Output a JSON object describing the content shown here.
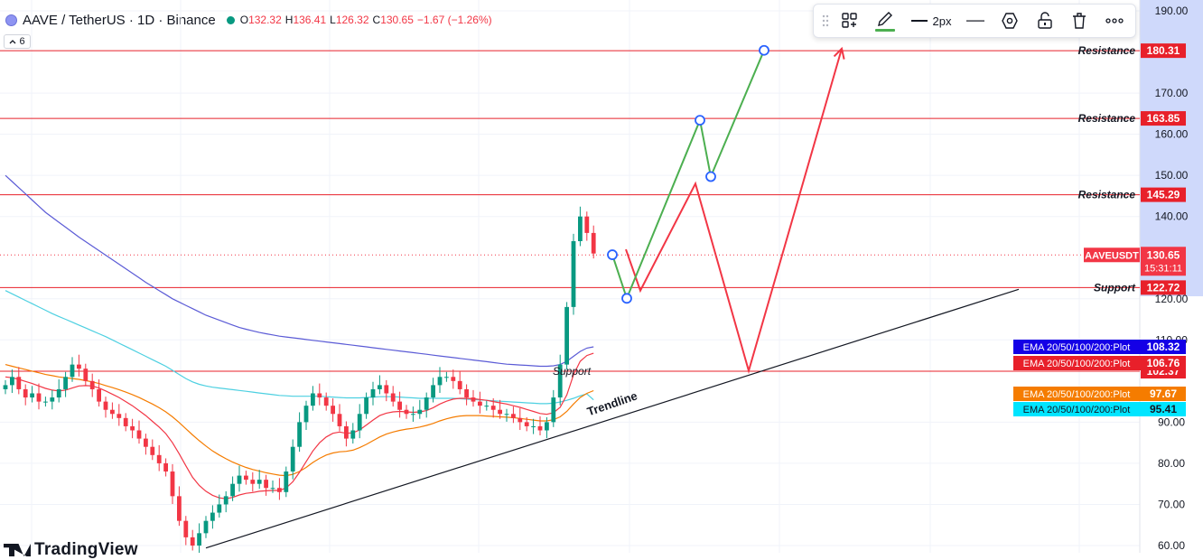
{
  "header": {
    "symbol": "AAVE / TetherUS · 1D · Binance",
    "open_key": "O",
    "open": "132.32",
    "high_key": "H",
    "high": "136.41",
    "low_key": "L",
    "low": "126.32",
    "close_key": "C",
    "close": "130.65",
    "change": "−1.67 (−1.26%)",
    "indicator_count": "6"
  },
  "toolbar": {
    "stroke_width": "2px"
  },
  "watermark": {
    "text": "TradingView"
  },
  "colors": {
    "up": "#089981",
    "down": "#f23645",
    "ema20": "#f23645",
    "ema50": "#f57c00",
    "ema100": "#4dd0e1",
    "ema200": "#5b5bd6",
    "projection_up": "#4caf50",
    "projection_down": "#f23645",
    "accent": "#2962ff"
  },
  "chart_data": {
    "type": "candlestick",
    "y_axis": {
      "min": 60,
      "max": 190,
      "ticks": [
        "190.00",
        "170.00",
        "160.00",
        "150.00",
        "140.00",
        "120.00",
        "110.00",
        "90.00",
        "80.00",
        "70.00",
        "60.00"
      ]
    },
    "levels": [
      {
        "label": "Resistance",
        "value": 180.31,
        "tag": "180.31"
      },
      {
        "label": "Resistance",
        "value": 163.85,
        "tag": "163.85"
      },
      {
        "label": "Resistance",
        "value": 145.29,
        "tag": "145.29"
      },
      {
        "label": "Support",
        "value": 122.72,
        "tag": "122.72"
      },
      {
        "label": "Support",
        "value": 102.37,
        "tag": "102.37"
      }
    ],
    "last_price": {
      "symbol": "AAVEUSDT",
      "value": 130.65,
      "tag": "130.65",
      "countdown": "15:31:11"
    },
    "ema_tags": [
      {
        "label": "EMA 20/50/100/200:Plot",
        "value": 108.32,
        "tag": "108.32",
        "color": "#1400e6"
      },
      {
        "label": "EMA 20/50/100/200:Plot",
        "value": 106.76,
        "tag": "106.76",
        "color": "#e8202a"
      },
      {
        "label": "EMA 20/50/100/200:Plot",
        "value": 97.67,
        "tag": "97.67",
        "color": "#f57c00"
      },
      {
        "label": "EMA 20/50/100/200:Plot",
        "value": 95.41,
        "tag": "95.41",
        "color": "#00e5ff"
      }
    ],
    "trendline_label": "Trendline",
    "candles_close": [
      99,
      101,
      98,
      96,
      97,
      95,
      95,
      96,
      98,
      101,
      104,
      103,
      100,
      98,
      95,
      93,
      92,
      91,
      89,
      88,
      86,
      84,
      82,
      80,
      78,
      72,
      66,
      62,
      60,
      63,
      66,
      68,
      70,
      72,
      75,
      77,
      76,
      75,
      76,
      74,
      74,
      73,
      78,
      84,
      90,
      94,
      97,
      96,
      94,
      92,
      89,
      86,
      88,
      92,
      96,
      98,
      99,
      97,
      95,
      93,
      92,
      92,
      93,
      96,
      99,
      101,
      101,
      100,
      98,
      96,
      95,
      94,
      94,
      93,
      92,
      92,
      91,
      90,
      89,
      89,
      88,
      90,
      96,
      104,
      118,
      134,
      140,
      136,
      131
    ],
    "ema200": [
      150,
      148.5,
      147,
      145.5,
      144,
      142.5,
      141,
      139.8,
      138.6,
      137.4,
      136.2,
      135,
      133.9,
      132.8,
      131.7,
      130.6,
      129.5,
      128.4,
      127.3,
      126.2,
      125.1,
      124,
      123,
      122,
      121,
      120,
      119.2,
      118.4,
      117.6,
      116.8,
      116,
      115.4,
      114.8,
      114.2,
      113.6,
      113,
      112.6,
      112.2,
      111.8,
      111.5,
      111.2,
      110.9,
      110.7,
      110.5,
      110.3,
      110.1,
      109.9,
      109.7,
      109.5,
      109.3,
      109.1,
      108.9,
      108.7,
      108.5,
      108.3,
      108.1,
      107.9,
      107.7,
      107.5,
      107.3,
      107.1,
      106.9,
      106.7,
      106.5,
      106.3,
      106.1,
      105.9,
      105.7,
      105.5,
      105.3,
      105.1,
      104.9,
      104.7,
      104.5,
      104.3,
      104.1,
      104,
      103.9,
      103.8,
      103.7,
      103.6,
      103.6,
      103.7,
      104,
      104.8,
      106,
      107.2,
      108,
      108.32
    ],
    "ema100": [
      122,
      121.2,
      120.4,
      119.6,
      118.8,
      118,
      117.2,
      116.4,
      115.7,
      115,
      114.3,
      113.6,
      112.9,
      112.2,
      111.5,
      110.8,
      110,
      109.2,
      108.4,
      107.6,
      106.8,
      106,
      105.2,
      104.4,
      103.6,
      102.6,
      101.6,
      100.6,
      99.8,
      99.2,
      98.8,
      98.5,
      98.3,
      98.1,
      97.9,
      97.7,
      97.5,
      97.3,
      97.1,
      96.9,
      96.7,
      96.5,
      96.4,
      96.3,
      96.3,
      96.3,
      96.3,
      96.3,
      96.2,
      96.1,
      96,
      95.9,
      95.9,
      95.9,
      96,
      96.1,
      96.2,
      96.2,
      96.2,
      96.1,
      96,
      95.9,
      95.8,
      95.8,
      95.8,
      95.8,
      95.8,
      95.8,
      95.7,
      95.6,
      95.5,
      95.4,
      95.3,
      95.2,
      95.1,
      95,
      94.9,
      94.8,
      94.7,
      94.6,
      94.5,
      94.5,
      94.6,
      94.9,
      95.3,
      95.8,
      96.4,
      96.9,
      95.41
    ],
    "ema50": [
      104,
      103.6,
      103.2,
      102.8,
      102.4,
      102,
      101.6,
      101.3,
      101,
      100.8,
      100.6,
      100.4,
      100.1,
      99.8,
      99.4,
      98.9,
      98.4,
      97.9,
      97.3,
      96.7,
      96,
      95.2,
      94.4,
      93.5,
      92.5,
      91.3,
      89.9,
      88.4,
      86.9,
      85.5,
      84.2,
      83,
      82,
      81.1,
      80.3,
      79.6,
      79,
      78.5,
      78.1,
      77.7,
      77.4,
      77.1,
      77,
      77.3,
      78,
      79,
      80.2,
      81.2,
      82,
      82.5,
      82.8,
      82.9,
      83.2,
      83.8,
      84.6,
      85.5,
      86.4,
      87.1,
      87.6,
      88,
      88.3,
      88.5,
      88.8,
      89.2,
      89.7,
      90.3,
      90.8,
      91.2,
      91.5,
      91.6,
      91.6,
      91.6,
      91.5,
      91.4,
      91.3,
      91.2,
      91.1,
      90.9,
      90.7,
      90.5,
      90.3,
      90.3,
      90.6,
      91.3,
      92.6,
      94.4,
      96,
      97,
      97.67
    ],
    "ema20": [
      101,
      100.8,
      100.4,
      99.9,
      99.4,
      98.8,
      98.2,
      97.8,
      97.6,
      97.8,
      98.3,
      98.8,
      98.9,
      98.8,
      98.3,
      97.6,
      96.8,
      96,
      95,
      94,
      92.8,
      91.6,
      90.2,
      88.8,
      87.2,
      85,
      82.3,
      79.4,
      76.6,
      74.6,
      73.2,
      72.2,
      71.6,
      71.4,
      71.7,
      72.3,
      72.7,
      72.9,
      73.2,
      73.3,
      73.4,
      73.4,
      74,
      75.5,
      77.8,
      80.4,
      83,
      85,
      86.4,
      87.3,
      87.6,
      87.3,
      87.4,
      88.1,
      89.3,
      90.5,
      91.6,
      92.2,
      92.5,
      92.6,
      92.5,
      92.4,
      92.5,
      92.8,
      93.5,
      94.4,
      95.1,
      95.6,
      95.8,
      95.8,
      95.7,
      95.5,
      95.3,
      95,
      94.7,
      94.4,
      94,
      93.6,
      93.1,
      92.6,
      92.1,
      91.9,
      92.3,
      93.6,
      96.6,
      101.5,
      104.8,
      106.2,
      106.76
    ],
    "projection_green": [
      [
        678,
        130.7
      ],
      [
        694,
        120.1
      ],
      [
        775,
        163.4
      ],
      [
        787,
        149.7
      ],
      [
        846,
        180.4
      ]
    ],
    "projection_red": [
      [
        693,
        132
      ],
      [
        709,
        122
      ],
      [
        770,
        148
      ],
      [
        829,
        102.5
      ],
      [
        932,
        180.8
      ]
    ]
  }
}
